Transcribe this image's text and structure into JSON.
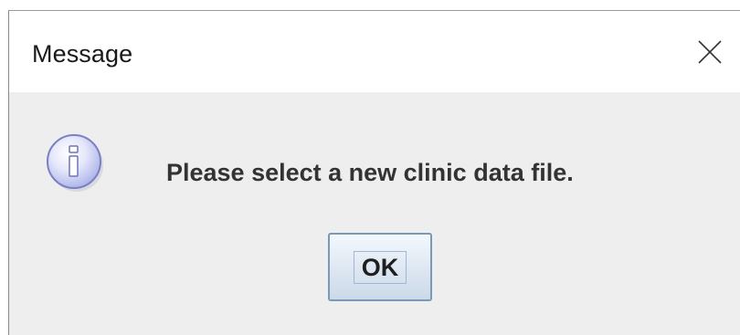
{
  "dialog": {
    "title": "Message",
    "close_icon": "close-icon",
    "info_icon": "info-icon",
    "message": "Please select a new clinic data file.",
    "ok_label": "OK"
  }
}
